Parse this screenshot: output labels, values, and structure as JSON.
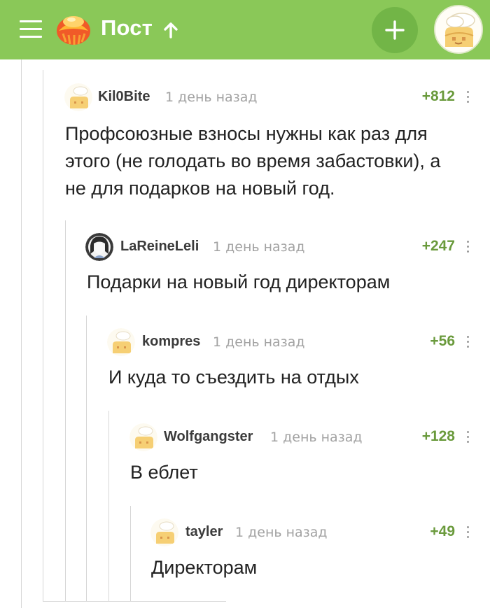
{
  "colors": {
    "header_bg": "#8ac858",
    "rating": "#6a9a3c"
  },
  "header": {
    "menu_icon": "hamburger-menu-icon",
    "logo_icon": "pikabu-logo-icon",
    "title": "Пост",
    "sort_icon": "arrow-up-icon",
    "add_icon": "plus-icon",
    "avatar_icon": "user-avatar-icon"
  },
  "comments": [
    {
      "username": "Kil0Bite",
      "time": "1 день назад",
      "rating": "+812",
      "text_lines": [
        "Профсоюзные взносы нужны как раз для",
        "этого (не голодать во время забастовки), а",
        "не для подарков на новый год."
      ]
    },
    {
      "username": "LaReineLeli",
      "time": "1 день назад",
      "rating": "+247",
      "text_lines": [
        "Подарки на новый год директорам"
      ]
    },
    {
      "username": "kompres",
      "time": "1 день назад",
      "rating": "+56",
      "text_lines": [
        "И куда то съездить на отдых"
      ]
    },
    {
      "username": "Wolfgangster",
      "time": "1 день назад",
      "rating": "+128",
      "text_lines": [
        "В еблет"
      ]
    },
    {
      "username": "tayler",
      "time": "1 день назад",
      "rating": "+49",
      "text_lines": [
        "Директорам"
      ]
    }
  ]
}
